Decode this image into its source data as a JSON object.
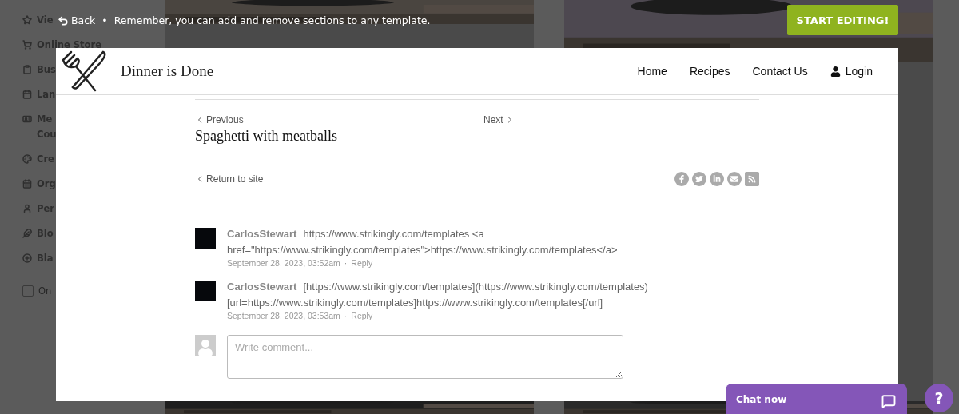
{
  "background": {
    "sidebar": [
      {
        "label": "Vie"
      },
      {
        "label": "Online Store"
      },
      {
        "label": "Bus"
      },
      {
        "label": "Lan"
      },
      {
        "label": "Me"
      },
      {
        "label": "Cou"
      },
      {
        "label": "Cre"
      },
      {
        "label": "Org"
      },
      {
        "label": "Per"
      },
      {
        "label": "Blo"
      },
      {
        "label": "Bla"
      }
    ],
    "checkbox": {
      "label": "On",
      "checked": false
    }
  },
  "top_bar": {
    "back": "Back",
    "separator": "•",
    "message": "Remember, you can add and remove sections to any template."
  },
  "start_button": "START EDITING!",
  "site": {
    "title": "Dinner is Done",
    "nav": [
      {
        "label": "Home",
        "kind": "link"
      },
      {
        "label": "Recipes",
        "kind": "link"
      },
      {
        "label": "Contact Us",
        "kind": "link"
      },
      {
        "label": "Login",
        "kind": "user"
      }
    ]
  },
  "post": {
    "previous": "Previous",
    "next": "Next",
    "title": "Spaghetti with meatballs",
    "return": "Return to site",
    "share": [
      {
        "kind": "facebook"
      },
      {
        "kind": "twitter"
      },
      {
        "kind": "linkedin"
      },
      {
        "kind": "email"
      },
      {
        "kind": "rss"
      }
    ]
  },
  "comments": [
    {
      "author": "CarlosStewart",
      "text": "https://www.strikingly.com/templates <a href=\"https://www.strikingly.com/templates\">https://www.strikingly.com/templates</a>",
      "date": "September 28, 2023, 03:52am",
      "separator": "·",
      "reply": "Reply"
    },
    {
      "author": "CarlosStewart",
      "text": "[https://www.strikingly.com/templates](https://www.strikingly.com/templates) [url=https://www.strikingly.com/templates]https://www.strikingly.com/templates[/url]",
      "date": "September 28, 2023, 03:53am",
      "separator": "·",
      "reply": "Reply"
    }
  ],
  "comment_box": {
    "placeholder": "Write comment..."
  },
  "chat": {
    "label": "Chat now"
  },
  "help": "?"
}
